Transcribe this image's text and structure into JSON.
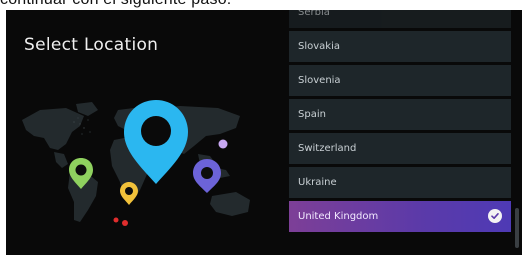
{
  "caption": {
    "text": "continuar con el siguiente paso:"
  },
  "screen": {
    "title": "Select Location",
    "countries": [
      "Serbia",
      "Slovakia",
      "Slovenia",
      "Spain",
      "Switzerland",
      "Ukraine",
      "United Kingdom"
    ],
    "selected_country": "United Kingdom",
    "selected_index": 6,
    "map": {
      "pin_colors": {
        "main": "#2bb7f0",
        "green": "#8fd15f",
        "yellow": "#f2c23a",
        "purple": "#6c63d8",
        "lavender": "#c9a9f3",
        "red": "#e02d2d"
      }
    }
  }
}
